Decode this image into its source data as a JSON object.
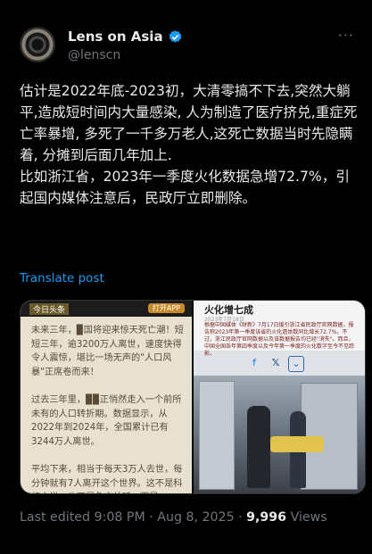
{
  "author": {
    "display_name": "Lens on Asia",
    "handle": "@lenscn",
    "verified_icon": "verified-badge-icon",
    "accent": "#1d9bf0"
  },
  "tweet": {
    "text": "估计是2022年底-2023初，大清零搞不下去,突然大躺平,造成短时间内大量感染, 人为制造了医疗挤兑,重症死亡率暴增, 多死了一千多万老人,这死亡数据当时先隐瞒着, 分摊到后面几年加上.\n比如浙江省，2023年一季度火化数据急增72.7%，引起国内媒体注意后，民政厅立即删除。",
    "translate_label": "Translate post"
  },
  "media": {
    "left": {
      "tag": "今日头条",
      "button": "打开APP",
      "text": "未来三年，▉国将迎来惊天死亡潮！短短三年，逾3200万人离世，速度快得令人震惊，堪比一场无声的\"人口风暴\"正席卷而来！\n\n过去三年里，▉▉正悄然走入一个前所未有的人口转折期。数据显示，从2022年到2024年，全国累计已有3244万人离世。\n\n平均下来，相当于每天3万人去世，每分钟就有7人离开这个世界。这不是科幻小说，也不是危言耸听，而是"
    },
    "right": {
      "title": "火化增七成",
      "date": "2023年7月18日",
      "paragraph": "根据中国媒体《财新》7月17日援引浙江省民政厅官网数据，报告称2023年第一季度该省的火化遗体数同比增长72.7%。不过，浙江民政厅官网数据以及该数据报告均已经\"消失\"。而且，中国全国各年第四季度以及今年第一季度的火化数字至今不见踪影。",
      "share_icons": [
        "facebook-icon",
        "x-icon",
        "chevron-down-icon"
      ]
    }
  },
  "meta": {
    "edited_label": "Last edited 9:08 PM · Aug 8, 2025 ·",
    "views_count": "9,996",
    "views_label": "Views"
  }
}
